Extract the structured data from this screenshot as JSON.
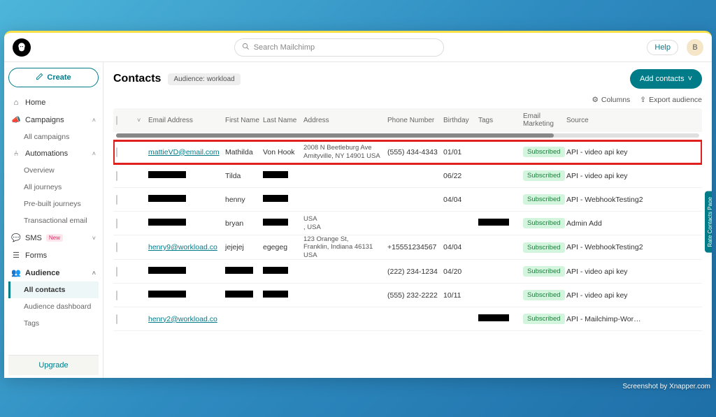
{
  "search": {
    "placeholder": "Search Mailchimp"
  },
  "header": {
    "help": "Help",
    "avatar": "B"
  },
  "sidebar": {
    "create": "Create",
    "home": "Home",
    "campaigns": "Campaigns",
    "all_campaigns": "All campaigns",
    "automations": "Automations",
    "overview": "Overview",
    "all_journeys": "All journeys",
    "prebuilt": "Pre-built journeys",
    "transactional": "Transactional email",
    "sms": "SMS",
    "sms_badge": "New",
    "forms": "Forms",
    "audience": "Audience",
    "all_contacts": "All contacts",
    "aud_dashboard": "Audience dashboard",
    "tags": "Tags",
    "upgrade": "Upgrade"
  },
  "page": {
    "title": "Contacts",
    "audience_label": "Audience: workload",
    "add_contacts": "Add contacts",
    "columns": "Columns",
    "export": "Export audience"
  },
  "columns": {
    "email": "Email Address",
    "first": "First Name",
    "last": "Last Name",
    "address": "Address",
    "phone": "Phone Number",
    "birthday": "Birthday",
    "tags": "Tags",
    "marketing": "Email Marketing",
    "source": "Source"
  },
  "rows": [
    {
      "email": "mattieVD@email.com",
      "first": "Mathilda",
      "last": "Von Hook",
      "address": "2008 N Beetleburg Ave\nAmityville, NY 14901 USA",
      "phone": "(555) 434-4343",
      "birthday": "01/01",
      "tags": "",
      "marketing": "Subscribed",
      "source": "API - video api key",
      "highlight": true,
      "redacted": false
    },
    {
      "email": "",
      "first": "Tilda",
      "last": "",
      "address": "",
      "phone": "",
      "birthday": "06/22",
      "tags": "",
      "marketing": "Subscribed",
      "source": "API - video api key",
      "redacted": true
    },
    {
      "email": "",
      "first": "henny",
      "last": "",
      "address": "",
      "phone": "",
      "birthday": "04/04",
      "tags": "",
      "marketing": "Subscribed",
      "source": "API - WebhookTesting2",
      "redacted": true
    },
    {
      "email": "",
      "first": "bryan",
      "last": "",
      "address": "USA\n, USA",
      "phone": "",
      "birthday": "",
      "tags": "redacted",
      "marketing": "Subscribed",
      "source": "Admin Add",
      "redacted": true
    },
    {
      "email": "henry9@workload.co",
      "first": "jejejej",
      "last": "egegeg",
      "address": "123 Orange St,\nFranklin, Indiana 46131 USA",
      "phone": "+15551234567",
      "birthday": "04/04",
      "tags": "",
      "marketing": "Subscribed",
      "source": "API - WebhookTesting2",
      "redacted": false
    },
    {
      "email": "",
      "first": "",
      "last": "",
      "address": "",
      "phone": "(222) 234-1234",
      "birthday": "04/20",
      "tags": "",
      "marketing": "Subscribed",
      "source": "API - video api key",
      "redacted": true
    },
    {
      "email": "",
      "first": "",
      "last": "",
      "address": "",
      "phone": "(555) 232-2222",
      "birthday": "10/11",
      "tags": "",
      "marketing": "Subscribed",
      "source": "API - video api key",
      "redacted": true
    },
    {
      "email": "henry2@workload.co",
      "first": "",
      "last": "",
      "address": "",
      "phone": "",
      "birthday": "",
      "tags": "redacted",
      "marketing": "Subscribed",
      "source": "API - Mailchimp-Workload Testi",
      "redacted": false
    }
  ],
  "side_tab": "Rate Contacts Page",
  "watermark": "Screenshot by Xnapper.com"
}
